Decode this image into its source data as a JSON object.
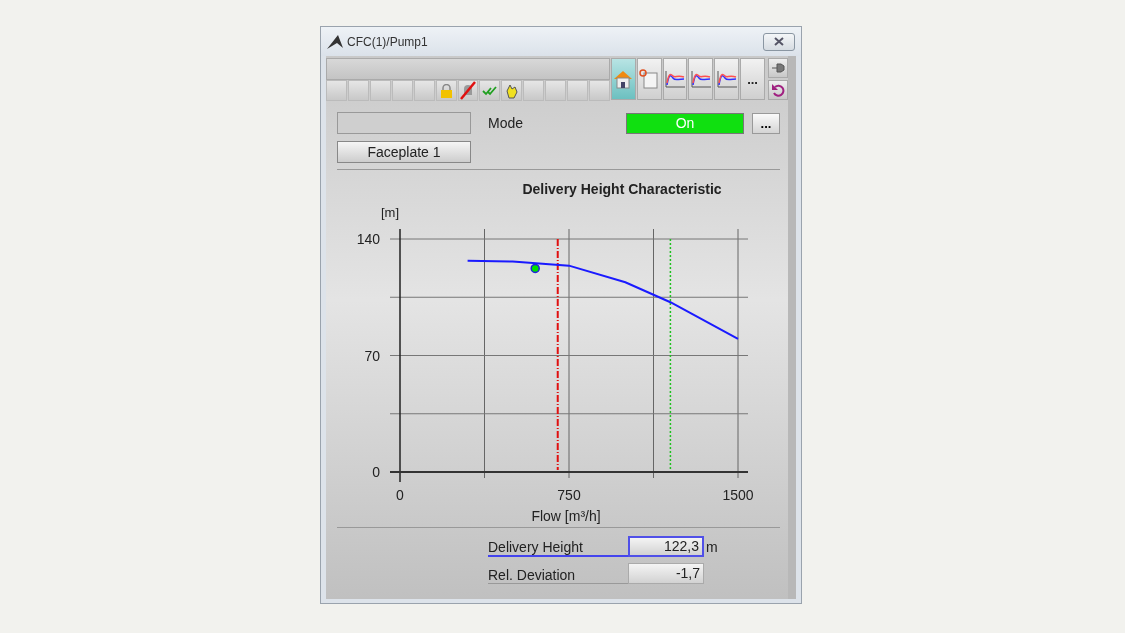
{
  "window": {
    "title": "CFC(1)/Pump1"
  },
  "toolbar": {
    "status_icons": [
      {
        "kind": "blank"
      },
      {
        "kind": "blank"
      },
      {
        "kind": "blank"
      },
      {
        "kind": "blank"
      },
      {
        "kind": "blank"
      },
      {
        "kind": "lock"
      },
      {
        "kind": "bell-off"
      },
      {
        "kind": "check"
      },
      {
        "kind": "hand"
      },
      {
        "kind": "blank"
      },
      {
        "kind": "blank"
      },
      {
        "kind": "blank"
      },
      {
        "kind": "blank"
      }
    ],
    "views": [
      {
        "kind": "home",
        "selected": true
      },
      {
        "kind": "doc",
        "selected": false
      },
      {
        "kind": "trend",
        "selected": false
      },
      {
        "kind": "trend",
        "selected": false
      },
      {
        "kind": "trend",
        "selected": false
      },
      {
        "kind": "more",
        "label": "...",
        "selected": false
      }
    ],
    "side": [
      {
        "kind": "pin"
      },
      {
        "kind": "back"
      }
    ]
  },
  "header": {
    "faceplate_button": "Faceplate 1",
    "mode_label": "Mode",
    "mode_value": "On",
    "mode_on": true,
    "mode_button": "..."
  },
  "chart": {
    "title": "Delivery Height Characteristic",
    "chart_data": {
      "type": "line",
      "xlabel": "Flow [m³/h]",
      "ylabel": "[m]",
      "xlim": [
        0,
        1500
      ],
      "ylim": [
        0,
        140
      ],
      "xticks": [
        0,
        750,
        1500
      ],
      "yticks": [
        0,
        70,
        140
      ],
      "x": [
        300,
        500,
        750,
        1000,
        1200,
        1500
      ],
      "series": [
        {
          "color": "#1a1aff",
          "values": [
            127,
            126.5,
            124,
            114,
            102,
            80
          ]
        },
        {
          "color": "#00e000",
          "x": [
            600
          ],
          "values": [
            122.3
          ],
          "marker": "circle"
        }
      ],
      "ref_lines": [
        {
          "axis": "x",
          "value": 700
        },
        {
          "axis": "x",
          "value": 1200
        }
      ]
    }
  },
  "values": [
    {
      "label": "Delivery Height",
      "value": "122,3",
      "unit": "m",
      "selected": true
    },
    {
      "label": "Rel. Deviation",
      "value": "-1,7",
      "selected": false
    }
  ]
}
